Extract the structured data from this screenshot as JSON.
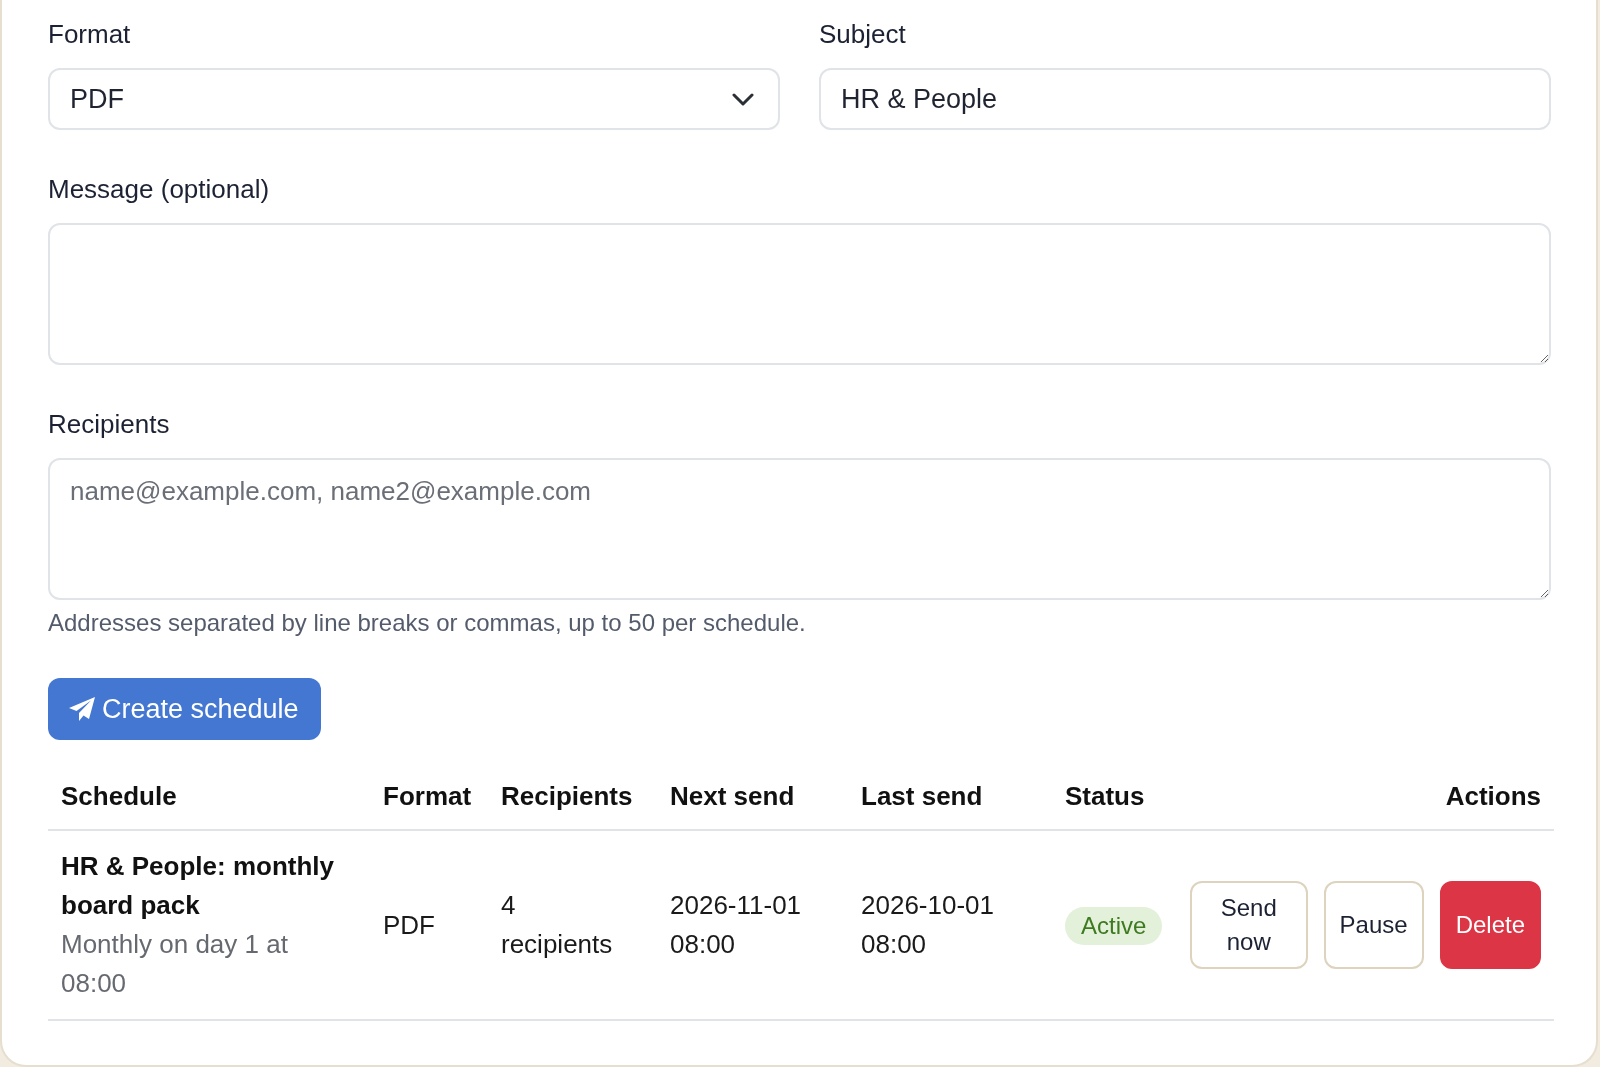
{
  "form": {
    "format": {
      "label": "Format",
      "value": "PDF"
    },
    "subject": {
      "label": "Subject",
      "value": "HR & People"
    },
    "message": {
      "label": "Message (optional)"
    },
    "recipients": {
      "label": "Recipients",
      "placeholder": "name@example.com, name2@example.com",
      "help": "Addresses separated by line breaks or commas, up to 50 per schedule."
    },
    "submit": {
      "label": "Create schedule"
    }
  },
  "table": {
    "columns": [
      "Schedule",
      "Format",
      "Recipients",
      "Next send",
      "Last send",
      "Status",
      "Actions"
    ],
    "rows": [
      {
        "schedule": {
          "title": "HR & People: monthly board pack",
          "detail": "Monthly on day 1 at 08:00"
        },
        "format": "PDF",
        "recipients": "4 recipients",
        "next_send": "2026-11-01 08:00",
        "last_send": "2026-10-01 08:00",
        "status": {
          "label": "Active",
          "kind": "active"
        },
        "actions": [
          {
            "label": "Send now",
            "kind": "outline"
          },
          {
            "label": "Pause",
            "kind": "outline"
          },
          {
            "label": "Delete",
            "kind": "danger"
          }
        ]
      }
    ]
  }
}
